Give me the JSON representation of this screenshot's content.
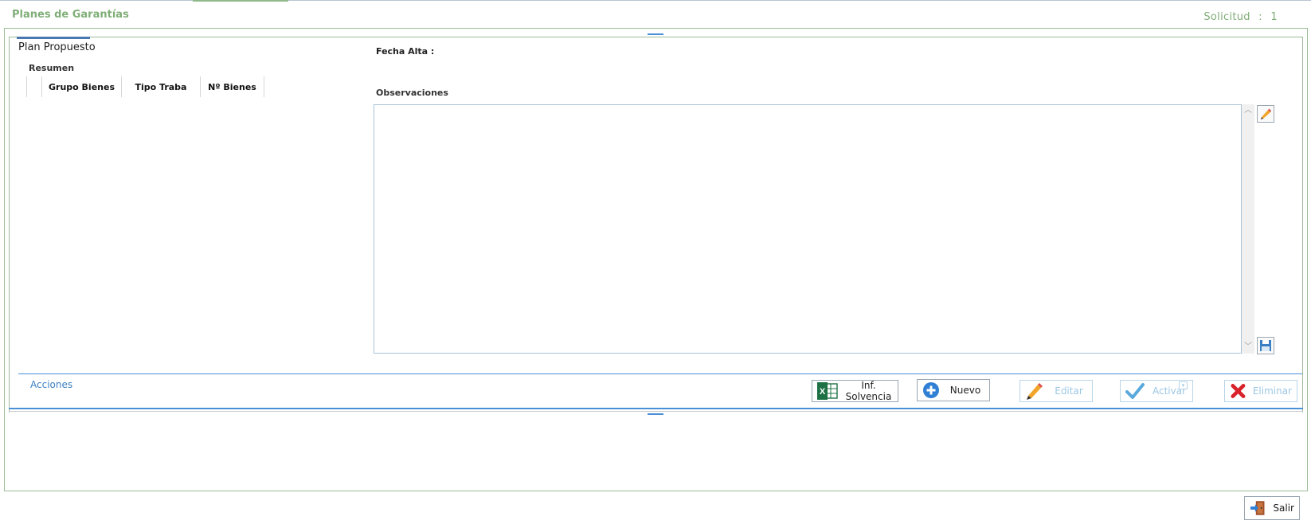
{
  "window": {
    "title": "Planes de Garantías",
    "solicitud_label": "Solicitud",
    "solicitud_sep": ":",
    "solicitud_value": "1"
  },
  "tabs": [
    {
      "label": "Plan Propuesto",
      "active": true
    }
  ],
  "resumen": {
    "title": "Resumen",
    "columns": [
      "Grupo Bienes",
      "Tipo Traba",
      "Nº Bienes"
    ],
    "rows": []
  },
  "form": {
    "fecha_alta_label": "Fecha Alta :",
    "fecha_alta_value": "",
    "observaciones_label": "Observaciones",
    "observaciones_value": ""
  },
  "acciones": {
    "title": "Acciones",
    "buttons": [
      {
        "label": "Inf. Solvencia",
        "icon": "excel-icon",
        "enabled": true
      },
      {
        "label": "Nuevo",
        "icon": "plus-circle-icon",
        "enabled": true
      },
      {
        "label": "Editar",
        "icon": "pencil-icon",
        "enabled": false
      },
      {
        "label": "Activar",
        "icon": "checkmark-icon",
        "enabled": false
      },
      {
        "label": "Eliminar",
        "icon": "x-icon",
        "enabled": false
      }
    ]
  },
  "footer": {
    "salir_label": "Salir"
  },
  "colors": {
    "accent_green": "#7fae77",
    "frame_green": "#9dbb98",
    "accent_blue": "#4a90d9",
    "disabled_text": "#9cc7e3"
  }
}
